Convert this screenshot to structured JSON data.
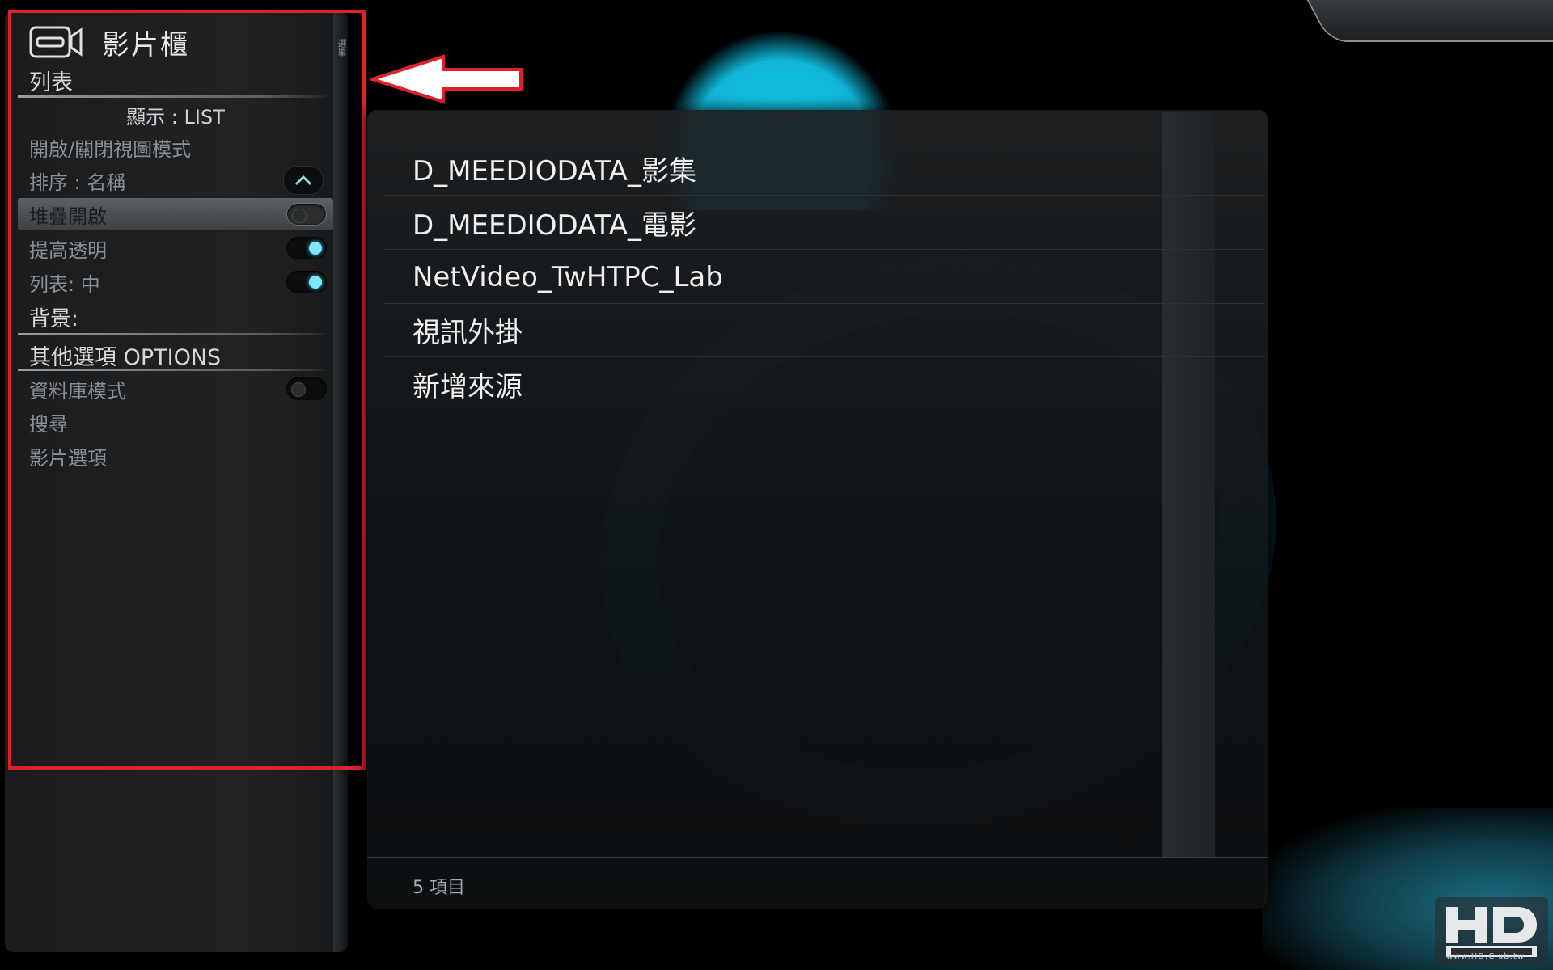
{
  "sidebar": {
    "title": "影片櫃",
    "vertical_label": "選單",
    "section_list": {
      "title": "列表",
      "display": "顯示 : LIST",
      "items": [
        {
          "label": "開啟/關閉視圖模式"
        },
        {
          "label": "排序 : 名稱"
        },
        {
          "label": "堆疊開啟",
          "toggle": "off",
          "selected": true
        },
        {
          "label": "提高透明",
          "toggle": "on"
        },
        {
          "label": "列表: 中",
          "toggle": "on"
        }
      ],
      "background_label": "背景:"
    },
    "section_options": {
      "title": "其他選項 OPTIONS",
      "items": [
        {
          "label": "資料庫模式",
          "toggle": "off"
        },
        {
          "label": "搜尋"
        },
        {
          "label": "影片選項"
        }
      ]
    }
  },
  "main": {
    "rows": [
      "D_MEEDIODATA_影集",
      "D_MEEDIODATA_電影",
      "NetVideo_TwHTPC_Lab",
      "視訊外掛",
      "新增來源"
    ],
    "footer": "5 項目"
  },
  "logo": {
    "text": "www.HD.Club.tw"
  },
  "colors": {
    "accent": "#19d2ef",
    "highlight_border": "#e2202a",
    "toggle_on": "#7fe6f6"
  }
}
